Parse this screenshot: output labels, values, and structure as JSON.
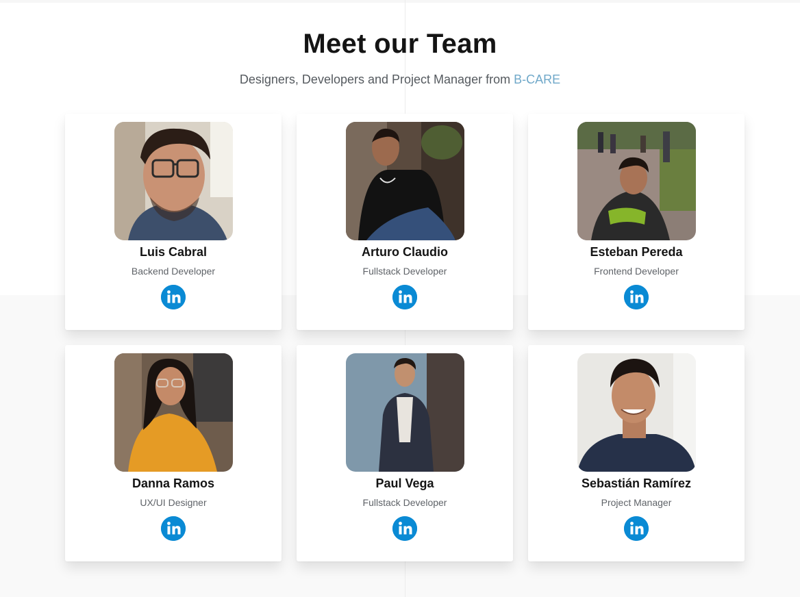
{
  "header": {
    "title": "Meet our Team",
    "subtitle_prefix": "Designers, Developers and Project Manager from ",
    "subtitle_brand": "B-CARE"
  },
  "colors": {
    "brand": "#6fa8c9",
    "linkedin": "#0a8ad4",
    "title": "#141414"
  },
  "team": [
    {
      "name": "Luis Cabral",
      "role": "Backend Developer",
      "icon": "linkedin-icon"
    },
    {
      "name": "Arturo Claudio",
      "role": "Fullstack Developer",
      "icon": "linkedin-icon"
    },
    {
      "name": "Esteban Pereda",
      "role": "Frontend Developer",
      "icon": "linkedin-icon"
    },
    {
      "name": "Danna Ramos",
      "role": "UX/UI Designer",
      "icon": "linkedin-icon"
    },
    {
      "name": "Paul Vega",
      "role": "Fullstack Developer",
      "icon": "linkedin-icon"
    },
    {
      "name": "Sebastián Ramírez",
      "role": "Project Manager",
      "icon": "linkedin-icon"
    }
  ]
}
